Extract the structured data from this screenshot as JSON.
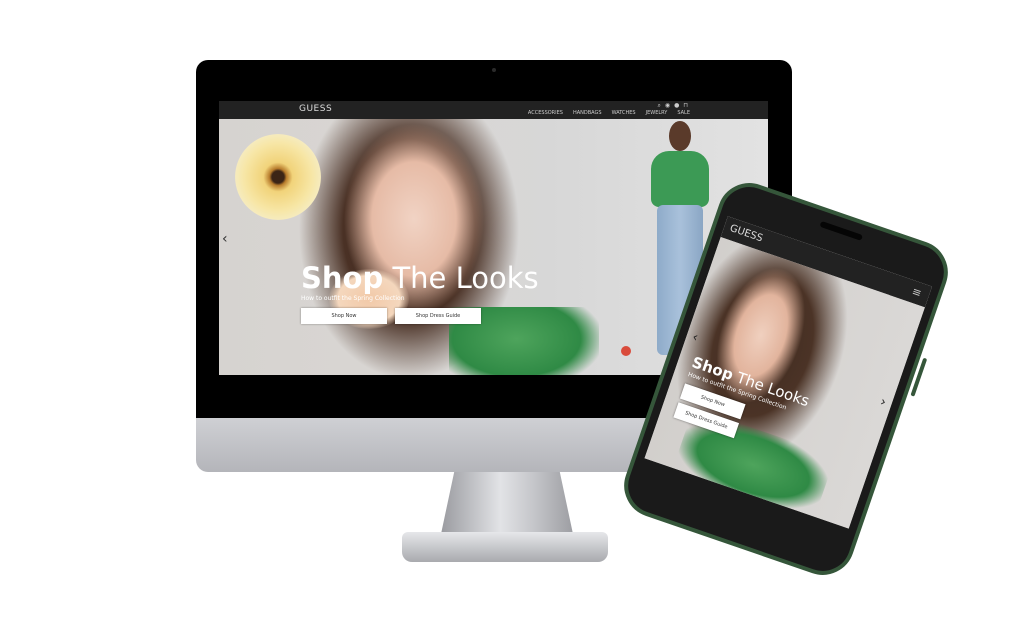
{
  "desktop": {
    "logo": "GUESS",
    "nav_icons": [
      "search-icon",
      "location-icon",
      "user-icon",
      "cart-icon"
    ],
    "nav_links": [
      "ACCESSORIES",
      "HANDBAGS",
      "WATCHES",
      "JEWELRY",
      "SALE"
    ],
    "hero": {
      "title_bold": "Shop",
      "title_rest": "The Looks",
      "subtitle": "How to outfit the Spring Collection",
      "buttons": [
        "Shop Now",
        "Shop Dress Guide"
      ],
      "prev_arrow": "‹"
    }
  },
  "phone": {
    "logo": "GUESS",
    "menu_icon": "≡",
    "hero": {
      "title_bold": "Shop",
      "title_rest": "The Looks",
      "subtitle": "How to outfit the Spring Collection",
      "buttons": [
        "Shop Now",
        "Shop Dress Guide"
      ],
      "prev_arrow": "‹",
      "next_arrow": "›"
    }
  },
  "colors": {
    "nav_bg": "#222222",
    "accent_green": "#3c9a55",
    "phone_frame": "#35563a"
  }
}
